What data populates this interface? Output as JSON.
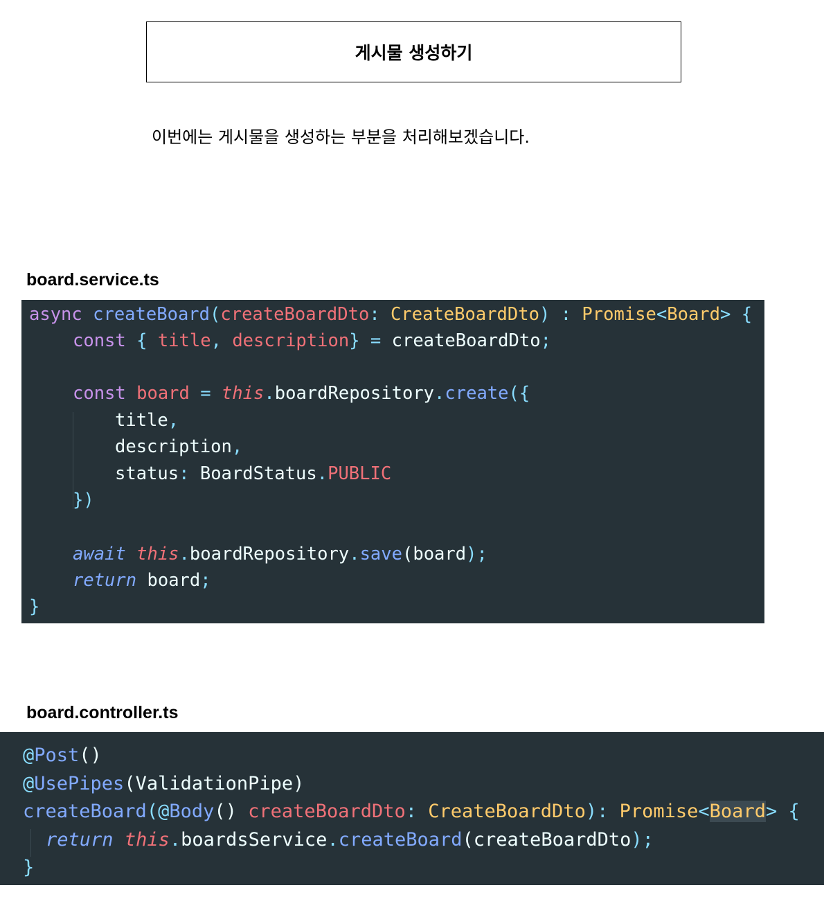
{
  "header": {
    "title": "게시물 생성하기"
  },
  "intro": {
    "text": "이번에는 게시물을 생성하는 부분을 처리해보겠습니다."
  },
  "service": {
    "filename": "board.service.ts",
    "lines": [
      [
        "async",
        " ",
        "createBoard",
        "(",
        "createBoardDto",
        ": ",
        "CreateBoardDto",
        ") ",
        ": ",
        "Promise",
        "<",
        "Board",
        ">",
        " {"
      ],
      [
        "const",
        " { ",
        "title",
        ", ",
        "description",
        "} = ",
        "createBoardDto",
        ";"
      ],
      [],
      [
        "const",
        " ",
        "board",
        " = ",
        "this",
        ".",
        "boardRepository",
        ".",
        "create",
        "({"
      ],
      [
        "title",
        ","
      ],
      [
        "description",
        ","
      ],
      [
        "status",
        ": ",
        "BoardStatus",
        ".",
        "PUBLIC"
      ],
      [
        "})"
      ],
      [],
      [
        "await",
        " ",
        "this",
        ".",
        "boardRepository",
        ".",
        "save",
        "(",
        "board",
        ");"
      ],
      [
        "return",
        " ",
        "board",
        ";"
      ],
      [
        "}"
      ]
    ]
  },
  "controller": {
    "filename": "board.controller.ts",
    "lines": [
      [
        "@",
        "Post",
        "()"
      ],
      [
        "@",
        "UsePipes",
        "(",
        "ValidationPipe",
        ")"
      ],
      [
        "createBoard",
        "(",
        "@",
        "Body",
        "() ",
        "createBoardDto",
        ": ",
        "CreateBoardDto",
        "): ",
        "Promise",
        "<",
        "Board",
        ">",
        " {"
      ],
      [
        "return",
        " ",
        "this",
        ".",
        "boardsService",
        ".",
        "createBoard",
        "(",
        "createBoardDto",
        ");"
      ],
      [
        "}"
      ]
    ]
  },
  "colors": {
    "code_bg": "#263238",
    "keyword": "#c792ea",
    "function": "#82aaff",
    "parameter": "#f07178",
    "type": "#ffcb6b",
    "punctuation": "#89ddff",
    "text": "#eeffff"
  }
}
